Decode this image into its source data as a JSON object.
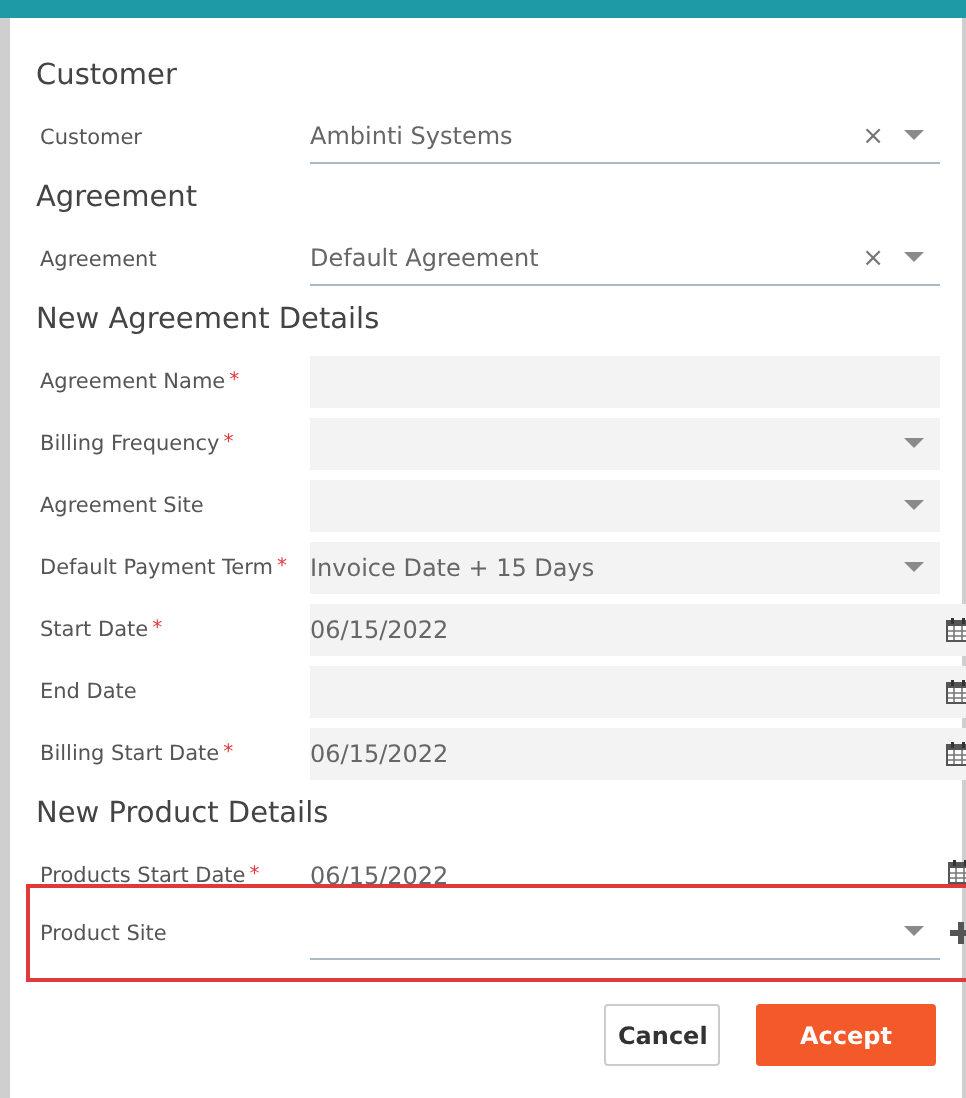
{
  "header": {
    "kind": "bar"
  },
  "sections": [
    {
      "title": "Customer",
      "fields": [
        {
          "label": "Customer",
          "kind": "select-line",
          "value": "Ambinti Systems",
          "clear": "×",
          "highlighted": false
        }
      ]
    },
    {
      "title": "Agreement",
      "fields": [
        {
          "label": "Agreement",
          "kind": "select-line",
          "value": "Default Agreement",
          "clear": "×",
          "highlighted": false
        }
      ]
    },
    {
      "title": "New Agreement Details",
      "fields": [
        {
          "label": "Agreement Name",
          "required_mark": "*",
          "kind": "text",
          "highlighted": false
        },
        {
          "label": "Billing Frequency",
          "required_mark": "*",
          "kind": "select",
          "highlighted": false
        },
        {
          "label": "Agreement Site",
          "kind": "select",
          "highlighted": false
        },
        {
          "label": "Default Payment Term",
          "required_mark": "*",
          "kind": "select",
          "value": "Invoice Date + 15 Days",
          "highlighted": false
        },
        {
          "label": "Start Date",
          "required_mark": "*",
          "kind": "date",
          "value": "06/15/2022",
          "highlighted": false
        },
        {
          "label": "End Date",
          "kind": "date",
          "highlighted": false
        },
        {
          "label": "Billing Start Date",
          "required_mark": "*",
          "kind": "date",
          "value": "06/15/2022",
          "highlighted": false
        }
      ]
    },
    {
      "title": "New Product Details",
      "fields": [
        {
          "label": "Products Start Date",
          "required_mark": "*",
          "kind": "date-plain",
          "value": "06/15/2022",
          "highlighted": false
        },
        {
          "label": "Product Site",
          "kind": "select-add",
          "highlighted": true
        }
      ]
    }
  ],
  "buttons": [
    {
      "label": "Cancel",
      "primary": false
    },
    {
      "label": "Accept",
      "primary": true
    }
  ]
}
